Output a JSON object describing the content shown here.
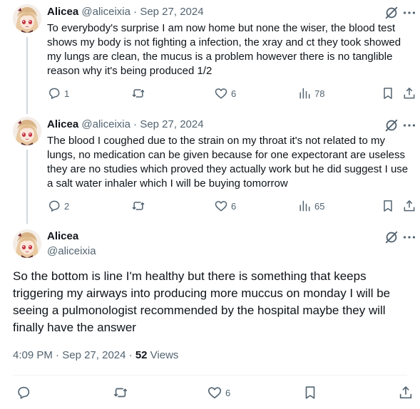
{
  "tweets": [
    {
      "name": "Alicea",
      "handle": "@aliceixia",
      "sep": "·",
      "date": "Sep 27, 2024",
      "text": "To everybody's surprise I am now home but none the wiser, the blood test shows my body is not fighting a infection, the xray and ct they took showed my lungs are clean, the mucus is a problem however there is no tanglible reason why it's being produced 1/2",
      "replies": "1",
      "retweets": "",
      "likes": "6",
      "views": "78"
    },
    {
      "name": "Alicea",
      "handle": "@aliceixia",
      "sep": "·",
      "date": "Sep 27, 2024",
      "text": "The blood I coughed due to the strain on my throat it's not related to my lungs, no medication can be given because for one expectorant are useless they are no studies which proved they actually work but he did suggest I use a salt water inhaler which I will be buying tomorrow",
      "replies": "2",
      "retweets": "",
      "likes": "6",
      "views": "65"
    }
  ],
  "main": {
    "name": "Alicea",
    "handle": "@aliceixia",
    "text": "So the bottom is line I'm healthy but there is something that keeps triggering my airways into producing more muccus on monday I will be seeing a pulmonologist recommended by the hospital maybe they will finally have the answer",
    "time": "4:09 PM",
    "sep": "·",
    "date": "Sep 27, 2024",
    "sep2": "·",
    "views_count": "52",
    "views_label": "Views",
    "replies": "",
    "retweets": "",
    "likes": "6"
  },
  "colors": {
    "muted": "#536471",
    "text": "#0f1419",
    "line": "#cfd9de"
  },
  "icons": [
    "grok-icon",
    "more-icon",
    "reply-icon",
    "retweet-icon",
    "like-icon",
    "views-icon",
    "bookmark-icon",
    "share-icon"
  ]
}
